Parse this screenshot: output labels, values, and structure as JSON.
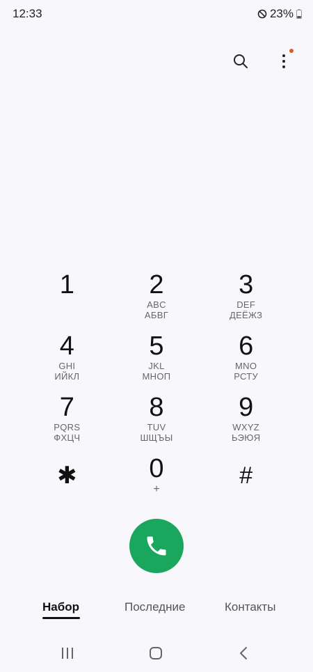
{
  "status_bar": {
    "time": "12:33",
    "battery_percent": "23%",
    "icons": [
      "do-not-disturb-icon",
      "battery-icon"
    ]
  },
  "top_actions": {
    "icons": [
      "search-icon",
      "more-options-icon"
    ],
    "notification_dot_color": "#e2582a"
  },
  "dialpad": {
    "keys": [
      {
        "digit": "1",
        "sub1": "",
        "sub2": ""
      },
      {
        "digit": "2",
        "sub1": "ABC",
        "sub2": "АБВГ"
      },
      {
        "digit": "3",
        "sub1": "DEF",
        "sub2": "ДЕЁЖЗ"
      },
      {
        "digit": "4",
        "sub1": "GHI",
        "sub2": "ИЙКЛ"
      },
      {
        "digit": "5",
        "sub1": "JKL",
        "sub2": "МНОП"
      },
      {
        "digit": "6",
        "sub1": "MNO",
        "sub2": "РСТУ"
      },
      {
        "digit": "7",
        "sub1": "PQRS",
        "sub2": "ФХЦЧ"
      },
      {
        "digit": "8",
        "sub1": "TUV",
        "sub2": "ШЩЪЫ"
      },
      {
        "digit": "9",
        "sub1": "WXYZ",
        "sub2": "ЬЭЮЯ"
      },
      {
        "digit": "✱",
        "sub1": "",
        "sub2": ""
      },
      {
        "digit": "0",
        "sub1": "+",
        "sub2": ""
      },
      {
        "digit": "#",
        "sub1": "",
        "sub2": ""
      }
    ]
  },
  "call_button": {
    "icon": "phone-icon",
    "color": "#1aa65c"
  },
  "tabs": [
    {
      "label": "Набор",
      "active": true
    },
    {
      "label": "Последние",
      "active": false
    },
    {
      "label": "Контакты",
      "active": false
    }
  ],
  "nav_bar": {
    "icons": [
      "recent-apps-icon",
      "home-icon",
      "back-icon"
    ]
  }
}
